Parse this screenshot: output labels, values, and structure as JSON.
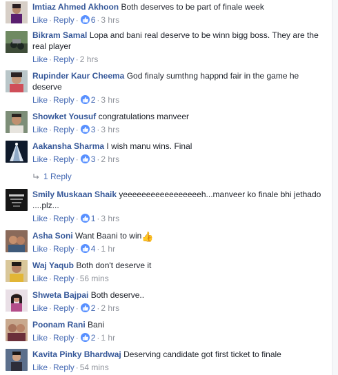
{
  "actions": {
    "like": "Like",
    "reply": "Reply"
  },
  "colors": {
    "author": "#365899",
    "action": "#4267b2",
    "meta": "#90949c",
    "reaction": "#5890ff"
  },
  "comments": [
    {
      "author": "Imtiaz Ahmed Akhoon",
      "text": "Both deserves to be part of finale week",
      "reactions": "6",
      "time": "3 hrs"
    },
    {
      "author": "Bikram Samal",
      "text": "Lopa and bani real deserve to be winn bigg boss. They are the real player",
      "reactions": "",
      "time": "2 hrs"
    },
    {
      "author": "Rupinder Kaur Cheema",
      "text": "God finaly sumthng happnd fair in the game he deserve",
      "reactions": "2",
      "time": "3 hrs"
    },
    {
      "author": "Showket Yousuf",
      "text": "congratulations manveer",
      "reactions": "3",
      "time": "3 hrs"
    },
    {
      "author": "Aakansha Sharma",
      "text": "I wish manu wins. Final",
      "reactions": "3",
      "time": "2 hrs"
    },
    {
      "author": "Smily Muskaan Shaik",
      "text": "yeeeeeeeeeeeeeeeeeh...manveer ko finale bhi jethado ....plz...",
      "reactions": "1",
      "time": "3 hrs"
    },
    {
      "author": "Asha Soni",
      "text": "Want Baani to win",
      "emoji": "👍",
      "reactions": "4",
      "time": "1 hr"
    },
    {
      "author": "Waj Yaqub",
      "text": "Both don't deserve it",
      "reactions": "",
      "time": "56 mins"
    },
    {
      "author": "Shweta Bajpai",
      "text": "Both deserve..",
      "reactions": "2",
      "time": "2 hrs"
    },
    {
      "author": "Poonam Rani",
      "text": "Bani",
      "reactions": "2",
      "time": "1 hr"
    },
    {
      "author": "Kavita Pinky Bhardwaj",
      "text": "Deserving candidate got first ticket to finale",
      "reactions": "",
      "time": "54 mins"
    }
  ],
  "replies_link": "1 Reply",
  "icons": {
    "reaction": "like-thumb-icon",
    "reply_arrow": "reply-arrow-icon",
    "emoji": "thumbs-up-emoji-icon"
  }
}
